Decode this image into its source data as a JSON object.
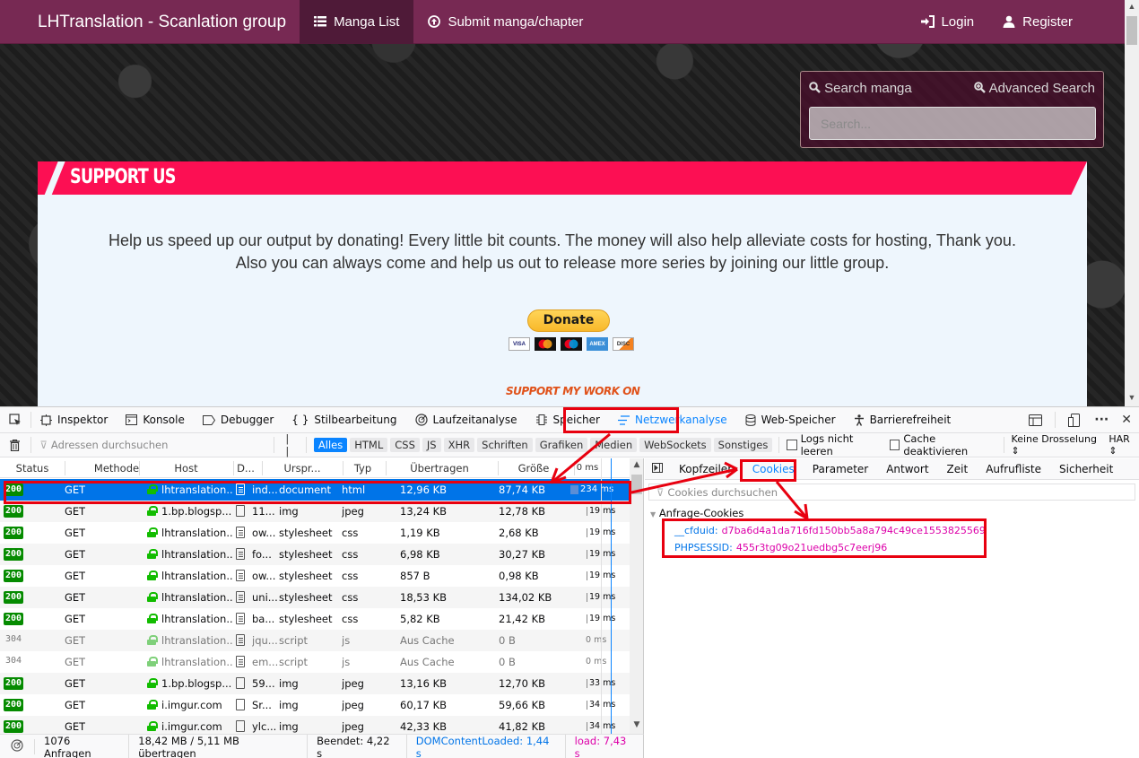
{
  "navbar": {
    "brand": "LHTranslation - Scanlation group",
    "items": [
      {
        "label": "Manga List",
        "icon": "list-icon",
        "active": true
      },
      {
        "label": "Submit manga/chapter",
        "icon": "upload-circle-icon",
        "active": false
      }
    ],
    "right_items": [
      {
        "label": "Login",
        "icon": "login-icon"
      },
      {
        "label": "Register",
        "icon": "user-icon"
      }
    ]
  },
  "search": {
    "title": "Search manga",
    "advanced_label": "Advanced Search",
    "placeholder": "Search..."
  },
  "support": {
    "title": "SUPPORT US",
    "line1": "Help us speed up our output by donating! Every little bit counts. The money will also help alleviate costs for hosting, Thank you.",
    "line2": "Also you can always come and help us out to release more series by joining our little group.",
    "donate_label": "Donate",
    "cards": [
      "VISA",
      "MC",
      "MAESTRO",
      "AMEX",
      "DISCOVER"
    ],
    "patreon_text": "SUPPORT MY WORK ON"
  },
  "devtools": {
    "tabs": [
      {
        "label": "Inspektor",
        "icon": "inspector-icon"
      },
      {
        "label": "Konsole",
        "icon": "console-icon"
      },
      {
        "label": "Debugger",
        "icon": "debugger-icon"
      },
      {
        "label": "Stilbearbeitung",
        "icon": "braces-icon"
      },
      {
        "label": "Laufzeitanalyse",
        "icon": "performance-icon"
      },
      {
        "label": "Speicher",
        "icon": "memory-icon"
      },
      {
        "label": "Netzwerkanalyse",
        "icon": "network-icon",
        "selected": true
      },
      {
        "label": "Web-Speicher",
        "icon": "storage-icon"
      },
      {
        "label": "Barrierefreiheit",
        "icon": "accessibility-icon"
      }
    ],
    "filter_placeholder": "Adressen durchsuchen",
    "pause_label": "| |",
    "type_filters": [
      "Alles",
      "HTML",
      "CSS",
      "JS",
      "XHR",
      "Schriften",
      "Grafiken",
      "Medien",
      "WebSockets",
      "Sonstiges"
    ],
    "active_type": "Alles",
    "persist_logs_label": "Logs nicht leeren",
    "disable_cache_label": "Cache deaktivieren",
    "throttling_label": "Keine Drosselung",
    "har_label": "HAR",
    "columns": [
      "Status",
      "Methode",
      "Host",
      "D...",
      "Urspr...",
      "Typ",
      "Übertragen",
      "Größe",
      "0 ms"
    ],
    "requests": [
      {
        "status": "200",
        "method": "GET",
        "host": "lhtranslation...",
        "file": "ind...",
        "cause": "document",
        "type": "html",
        "transferred": "12,96 KB",
        "size": "87,74 KB",
        "time": "234 ms",
        "doc": true,
        "selected": true
      },
      {
        "status": "200",
        "method": "GET",
        "host": "1.bp.blogsp...",
        "file": "11...",
        "cause": "img",
        "type": "jpeg",
        "transferred": "13,24 KB",
        "size": "12,78 KB",
        "time": "19 ms",
        "doc": false
      },
      {
        "status": "200",
        "method": "GET",
        "host": "lhtranslation...",
        "file": "ow...",
        "cause": "stylesheet",
        "type": "css",
        "transferred": "1,19 KB",
        "size": "2,68 KB",
        "time": "19 ms",
        "doc": true
      },
      {
        "status": "200",
        "method": "GET",
        "host": "lhtranslation...",
        "file": "fo...",
        "cause": "stylesheet",
        "type": "css",
        "transferred": "6,98 KB",
        "size": "30,27 KB",
        "time": "19 ms",
        "doc": true
      },
      {
        "status": "200",
        "method": "GET",
        "host": "lhtranslation...",
        "file": "ow...",
        "cause": "stylesheet",
        "type": "css",
        "transferred": "857 B",
        "size": "0,98 KB",
        "time": "19 ms",
        "doc": true
      },
      {
        "status": "200",
        "method": "GET",
        "host": "lhtranslation...",
        "file": "uni...",
        "cause": "stylesheet",
        "type": "css",
        "transferred": "18,53 KB",
        "size": "134,02 KB",
        "time": "19 ms",
        "doc": true
      },
      {
        "status": "200",
        "method": "GET",
        "host": "lhtranslation...",
        "file": "ba...",
        "cause": "stylesheet",
        "type": "css",
        "transferred": "5,82 KB",
        "size": "21,42 KB",
        "time": "19 ms",
        "doc": true
      },
      {
        "status": "304",
        "method": "GET",
        "host": "lhtranslation...",
        "file": "jqu...",
        "cause": "script",
        "type": "js",
        "transferred": "Aus Cache",
        "size": "0 B",
        "time": "0 ms",
        "doc": true,
        "cached": true
      },
      {
        "status": "304",
        "method": "GET",
        "host": "lhtranslation...",
        "file": "em...",
        "cause": "script",
        "type": "js",
        "transferred": "Aus Cache",
        "size": "0 B",
        "time": "0 ms",
        "doc": true,
        "cached": true
      },
      {
        "status": "200",
        "method": "GET",
        "host": "1.bp.blogsp...",
        "file": "59...",
        "cause": "img",
        "type": "jpeg",
        "transferred": "13,16 KB",
        "size": "12,70 KB",
        "time": "33 ms",
        "doc": false
      },
      {
        "status": "200",
        "method": "GET",
        "host": "i.imgur.com",
        "file": "Sr...",
        "cause": "img",
        "type": "jpeg",
        "transferred": "60,17 KB",
        "size": "59,66 KB",
        "time": "34 ms",
        "doc": false
      },
      {
        "status": "200",
        "method": "GET",
        "host": "i.imgur.com",
        "file": "ylc...",
        "cause": "img",
        "type": "jpeg",
        "transferred": "42,33 KB",
        "size": "41,82 KB",
        "time": "34 ms",
        "doc": false
      }
    ],
    "summary": {
      "requests": "1076 Anfragen",
      "transferred": "18,42 MB / 5,11 MB übertragen",
      "finished": "Beendet: 4,22 s",
      "dom_loaded": "DOMContentLoaded: 1,44 s",
      "load": "load: 7,43 s",
      "dom_color": "#0074e8",
      "load_color": "#dd00a9"
    },
    "detail_tabs": [
      "Kopfzeilen",
      "Cookies",
      "Parameter",
      "Antwort",
      "Zeit",
      "Aufrufliste",
      "Sicherheit"
    ],
    "selected_detail_tab": "Cookies",
    "cookie_filter_placeholder": "Cookies durchsuchen",
    "cookie_section": "Anfrage-Cookies",
    "cookies": [
      {
        "name": "__cfduid:",
        "value": "d7ba6d4a1da716fd150bb5a8a794c49ce1553825569"
      },
      {
        "name": "PHPSESSID:",
        "value": "455r3tg09o21uedbg5c7eerj96"
      }
    ]
  },
  "colors": {
    "navbar": "#772953",
    "support_header": "#fc0f53",
    "devtools_accent": "#0a84ff",
    "annotation": "#e8000f"
  }
}
